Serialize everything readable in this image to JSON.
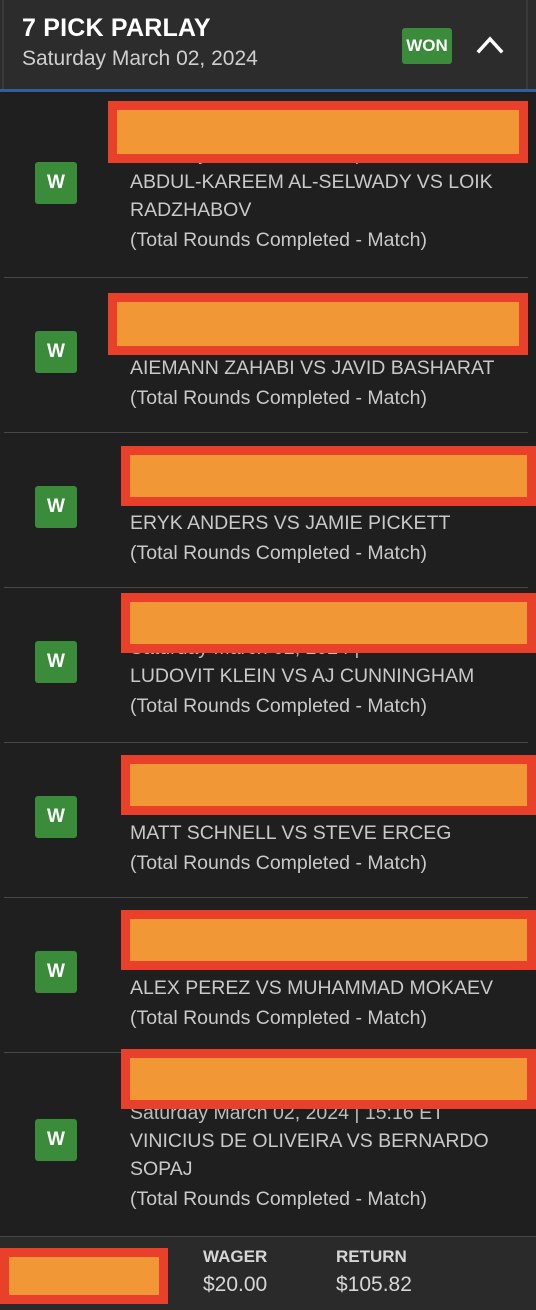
{
  "header": {
    "title": "7 PICK PARLAY",
    "date": "Saturday March 02, 2024",
    "status": "WON"
  },
  "legs": [
    {
      "result": "W",
      "datetime": "Saturday March 02, 2024 |",
      "matchup": "ABDUL-KAREEM AL-SELWADY VS LOIK RADZHABOV",
      "market": "(Total Rounds Completed - Match)"
    },
    {
      "result": "W",
      "datetime": "",
      "matchup": "AIEMANN ZAHABI VS JAVID BASHARAT",
      "market": "(Total Rounds Completed - Match)"
    },
    {
      "result": "W",
      "datetime": "",
      "matchup": "ERYK ANDERS VS JAMIE PICKETT",
      "market": "(Total Rounds Completed - Match)"
    },
    {
      "result": "W",
      "datetime": "Saturday March 02, 2024 |",
      "matchup": "LUDOVIT KLEIN VS AJ CUNNINGHAM",
      "market": "(Total Rounds Completed - Match)"
    },
    {
      "result": "W",
      "datetime": "",
      "matchup": "MATT SCHNELL VS STEVE ERCEG",
      "market": "(Total Rounds Completed - Match)"
    },
    {
      "result": "W",
      "datetime": "",
      "matchup": "ALEX PEREZ VS MUHAMMAD MOKAEV",
      "market": "(Total Rounds Completed - Match)"
    },
    {
      "result": "W",
      "datetime": "Saturday March 02, 2024 |  15:16 ET",
      "matchup": "VINICIUS DE OLIVEIRA VS BERNARDO SOPAJ",
      "market": "(Total Rounds Completed - Match)"
    }
  ],
  "footer": {
    "wager_label": "WAGER",
    "wager_value": "$20.00",
    "return_label": "RETURN",
    "return_value": "$105.82"
  },
  "colors": {
    "won_green": "#3b8c3a",
    "redaction_fill": "#f19735",
    "redaction_border": "#e8402a",
    "header_underline": "#2f5f9e"
  }
}
